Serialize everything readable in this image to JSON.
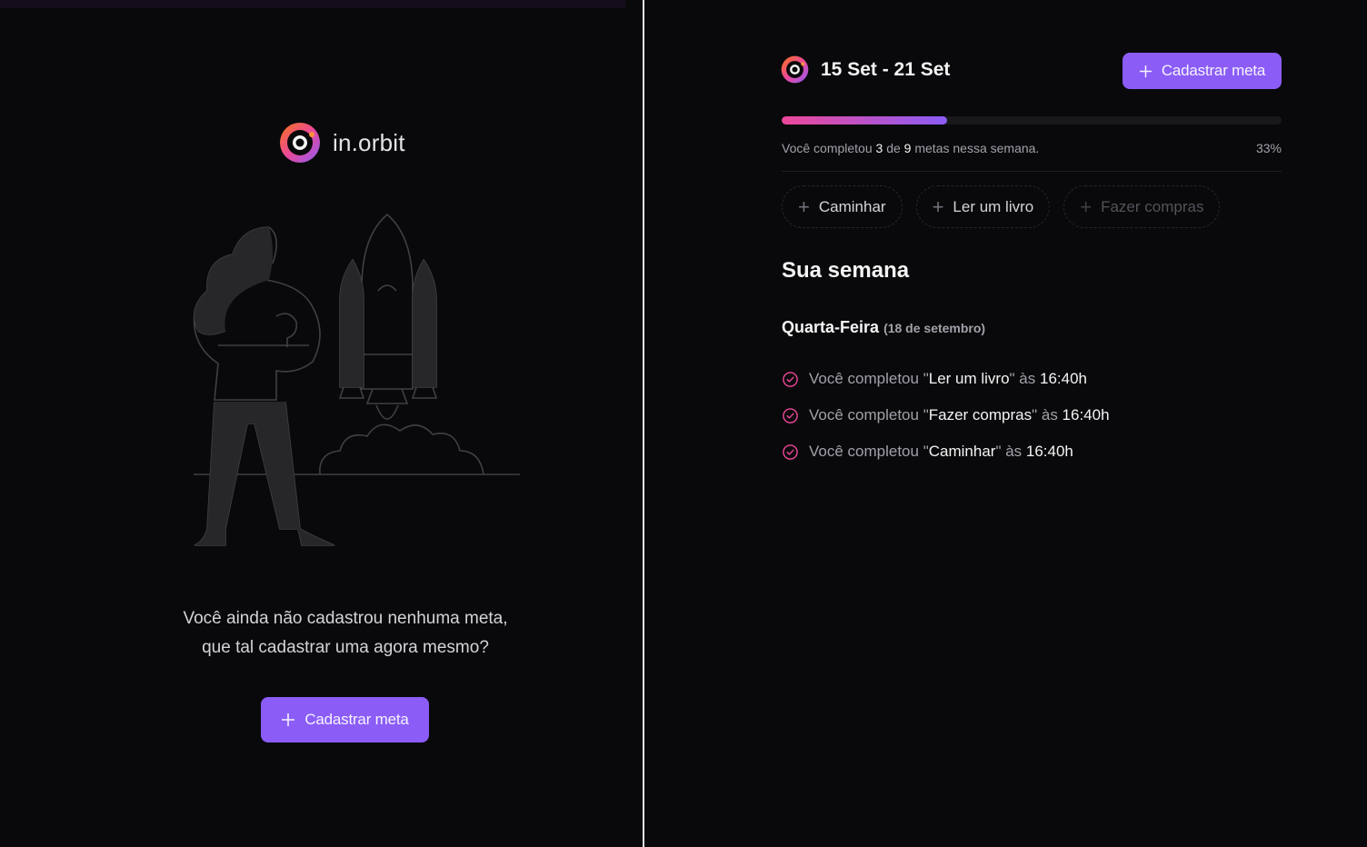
{
  "left": {
    "brand": {
      "name": "in.orbit",
      "logo_icon": "orbit-logo-icon"
    },
    "empty_state": {
      "line1": "Você ainda não cadastrou nenhuma meta,",
      "line2": "que tal cadastrar uma agora mesmo?"
    },
    "cta": {
      "icon": "plus-icon",
      "label": "Cadastrar meta"
    }
  },
  "right": {
    "header": {
      "logo_icon": "orbit-logo-icon",
      "week_range": "15 Set - 21 Set",
      "cta_label": "Cadastrar meta"
    },
    "progress": {
      "prefix": "Você completou",
      "completed": "3",
      "of": "de",
      "total": "9",
      "suffix": "metas nessa semana.",
      "percent_label": "33%",
      "fraction": 0.33
    },
    "chips": [
      {
        "label": "Caminhar",
        "enabled": true
      },
      {
        "label": "Ler um livro",
        "enabled": true
      },
      {
        "label": "Fazer compras",
        "enabled": false
      }
    ],
    "week_title": "Sua semana",
    "days": [
      {
        "weekday": "Quarta-Feira",
        "date": "(18 de setembro)",
        "entries": [
          {
            "prefix": "Você completou \"",
            "goal": "Ler um livro",
            "mid": "\" às ",
            "time": "16:40h"
          },
          {
            "prefix": "Você completou \"",
            "goal": "Fazer compras",
            "mid": "\" às ",
            "time": "16:40h"
          },
          {
            "prefix": "Você completou \"",
            "goal": "Caminhar",
            "mid": "\" às ",
            "time": "16:40h"
          }
        ]
      }
    ]
  },
  "colors": {
    "background": "#09090b",
    "accent_violet": "#8b5cf6",
    "accent_pink": "#ec4899",
    "text_muted": "#a1a1aa"
  }
}
